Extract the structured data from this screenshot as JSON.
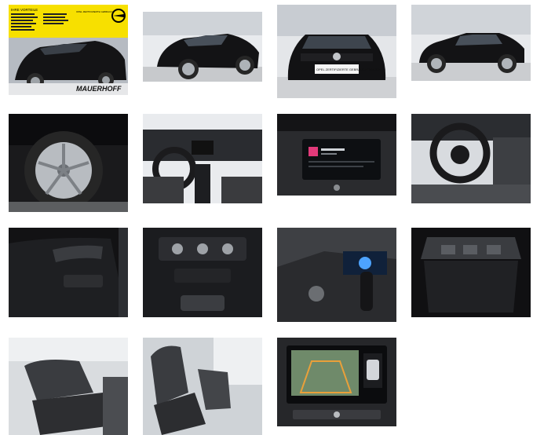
{
  "gallery": {
    "photos": [
      {
        "id": "exterior-front-dealer",
        "banner_heading": "IHRE VORTEILE",
        "banner_badge": "OPEL ZERTIFIZIERTE GEBRAUCHTWAGEN",
        "dealer_name": "MAUERHOFF"
      },
      {
        "id": "exterior-rear-side"
      },
      {
        "id": "exterior-front",
        "plate_text": "OPEL ZERTIFIZIERTE GEBRAUCHTWAGEN"
      },
      {
        "id": "exterior-side"
      },
      {
        "id": "wheel-rim"
      },
      {
        "id": "dashboard"
      },
      {
        "id": "infotainment-screen"
      },
      {
        "id": "steering-wheel"
      },
      {
        "id": "door-panel"
      },
      {
        "id": "climate-controls"
      },
      {
        "id": "gear-shifter"
      },
      {
        "id": "trunk"
      },
      {
        "id": "rear-seats"
      },
      {
        "id": "front-seats"
      },
      {
        "id": "rear-camera-display"
      }
    ]
  },
  "colors": {
    "banner_yellow": "#f7e000",
    "car_black": "#121214",
    "showroom_gray": "#c9cdd2"
  }
}
